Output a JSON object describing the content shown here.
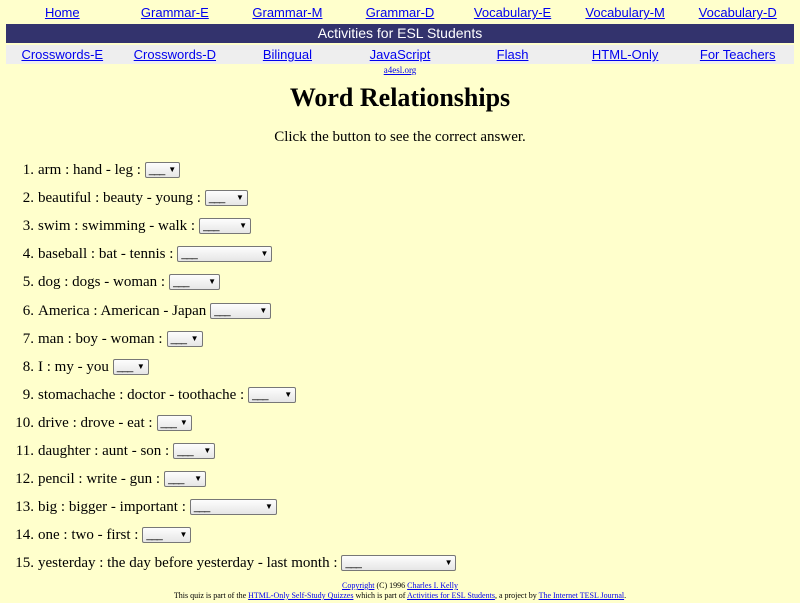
{
  "nav_top": [
    "Home",
    "Grammar-E",
    "Grammar-M",
    "Grammar-D",
    "Vocabulary-E",
    "Vocabulary-M",
    "Vocabulary-D"
  ],
  "banner": "Activities for ESL Students",
  "nav_bottom": [
    "Crosswords-E",
    "Crosswords-D",
    "Bilingual",
    "JavaScript",
    "Flash",
    "HTML-Only",
    "For Teachers"
  ],
  "site_url": "a4esl.org",
  "title": "Word Relationships",
  "instructions": "Click the button to see the correct answer.",
  "questions": [
    {
      "num": "1.",
      "text": "arm : hand - leg :",
      "selected": "___"
    },
    {
      "num": "2.",
      "text": "beautiful : beauty - young :",
      "selected": "___"
    },
    {
      "num": "3.",
      "text": "swim : swimming - walk :",
      "selected": "___"
    },
    {
      "num": "4.",
      "text": "baseball : bat - tennis :",
      "selected": "___"
    },
    {
      "num": "5.",
      "text": "dog : dogs - woman :",
      "selected": "___"
    },
    {
      "num": "6.",
      "text": "America : American - Japan",
      "selected": "___"
    },
    {
      "num": "7.",
      "text": "man : boy - woman :",
      "selected": "___"
    },
    {
      "num": "8.",
      "text": "I : my - you",
      "selected": "___"
    },
    {
      "num": "9.",
      "text": "stomachache : doctor - toothache :",
      "selected": "___"
    },
    {
      "num": "10.",
      "text": "drive : drove - eat :",
      "selected": "___"
    },
    {
      "num": "11.",
      "text": "daughter : aunt - son :",
      "selected": "___"
    },
    {
      "num": "12.",
      "text": "pencil : write - gun :",
      "selected": "___"
    },
    {
      "num": "13.",
      "text": "big : bigger - important :",
      "selected": "___"
    },
    {
      "num": "14.",
      "text": "one : two - first :",
      "selected": "___"
    },
    {
      "num": "15.",
      "text": "yesterday : the day before yesterday - last month :",
      "selected": "___"
    }
  ],
  "footer": {
    "copyright": "Copyright",
    "year": "(C) 1996",
    "author": "Charles I. Kelly",
    "line2_a": "This quiz is part of the",
    "line2_link1": "HTML-Only Self-Study Quizzes",
    "line2_b": "which is part of",
    "line2_link2": "Activities for ESL Students",
    "line2_c": ", a project by",
    "line2_link3": "The Internet TESL Journal",
    "line2_d": "."
  },
  "arrow_icon": "chevron-down-icon",
  "colors": {
    "background": "#ffffcc",
    "banner": "#33336d",
    "link": "#0000ee"
  }
}
